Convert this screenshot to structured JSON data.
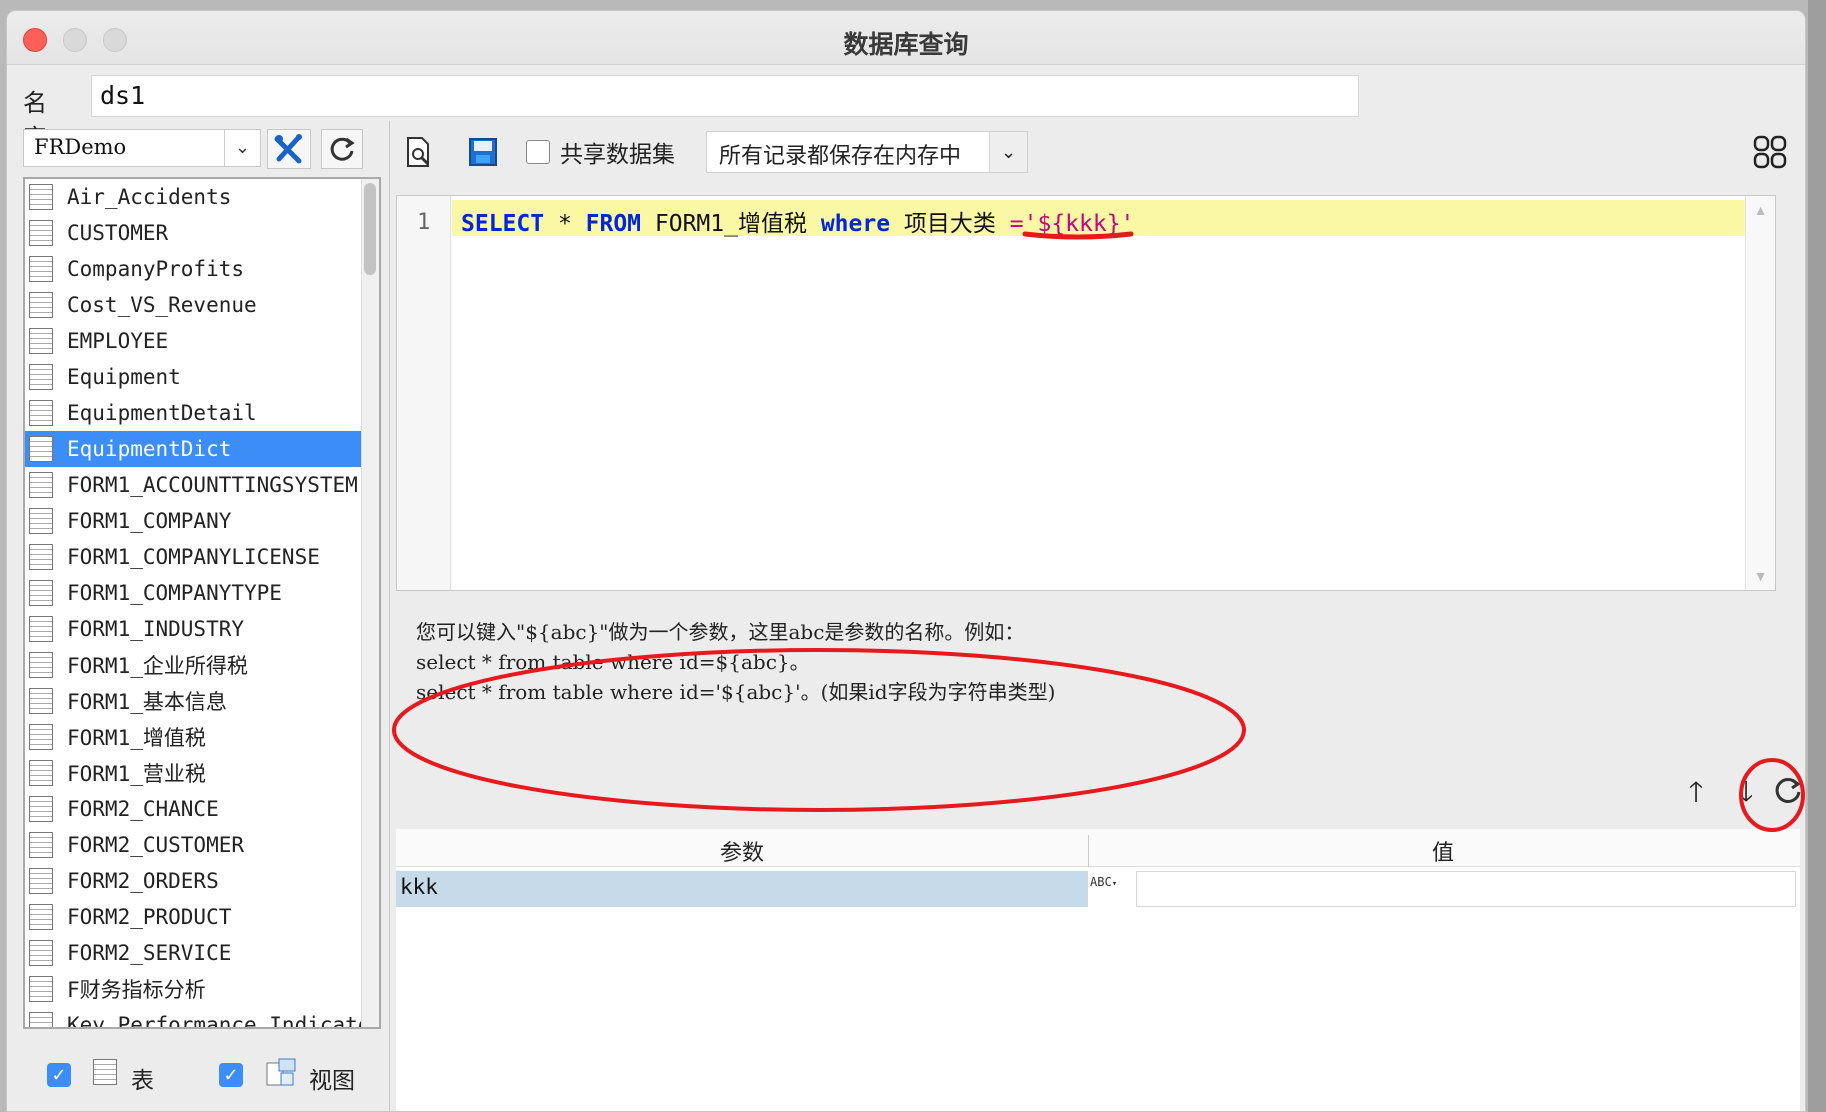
{
  "window": {
    "title": "数据库查询"
  },
  "name": {
    "label": "名字:",
    "value": "ds1"
  },
  "datasource": {
    "selected": "FRDemo",
    "tables": [
      "Air_Accidents",
      "CUSTOMER",
      "CompanyProfits",
      "Cost_VS_Revenue",
      "EMPLOYEE",
      "Equipment",
      "EquipmentDetail",
      "EquipmentDict",
      "FORM1_ACCOUNTTINGSYSTEM",
      "FORM1_COMPANY",
      "FORM1_COMPANYLICENSE",
      "FORM1_COMPANYTYPE",
      "FORM1_INDUSTRY",
      "FORM1_企业所得税",
      "FORM1_基本信息",
      "FORM1_增值税",
      "FORM1_营业税",
      "FORM2_CHANCE",
      "FORM2_CUSTOMER",
      "FORM2_ORDERS",
      "FORM2_PRODUCT",
      "FORM2_SERVICE",
      "F财务指标分析",
      "Key_Performance_Indicator"
    ],
    "selected_table": "EquipmentDict",
    "filter_table_label": "表",
    "filter_view_label": "视图"
  },
  "toolbar": {
    "share_label": "共享数据集",
    "memory_mode": "所有记录都保存在内存中"
  },
  "editor": {
    "line_number": "1",
    "sql": {
      "kw_select": "SELECT",
      "star": " * ",
      "kw_from": "FROM",
      "table": " FORM1_增值税 ",
      "kw_where": "where",
      "column": " 项目大类 ",
      "eq": "=",
      "param": "'${kkk}'"
    }
  },
  "hint": {
    "line1": "您可以键入\"${abc}\"做为一个参数，这里abc是参数的名称。例如：",
    "line2": "select * from table where id=${abc}。",
    "line3": "select * from table where id='${abc}'。(如果id字段为字符串类型)"
  },
  "params": {
    "col_param": "参数",
    "col_value": "值",
    "rows": [
      {
        "name": "kkk",
        "type": "ABC",
        "value": ""
      }
    ]
  },
  "colors": {
    "accent": "#3b8ef7",
    "annotation": "#e8191c",
    "current_line": "#fbf8a5"
  }
}
